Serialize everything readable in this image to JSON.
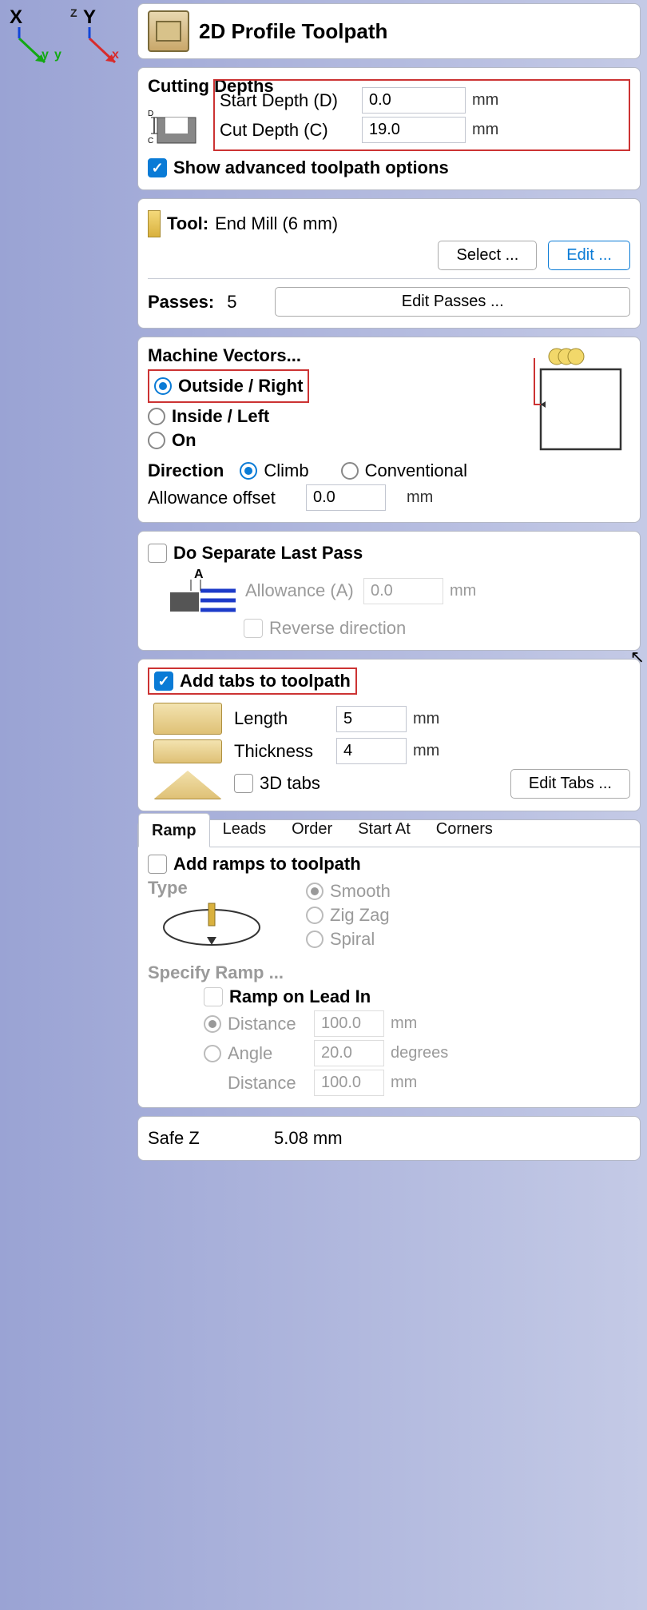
{
  "axes": {
    "x_label": "X",
    "y_label": "Y",
    "z_label": "Z",
    "sub_y": "y",
    "sub_x": "x"
  },
  "header": {
    "title": "2D Profile Toolpath"
  },
  "depths": {
    "section": "Cutting Depths",
    "start_label": "Start Depth (D)",
    "start_value": "0.0",
    "cut_label": "Cut Depth (C)",
    "cut_value": "19.0",
    "unit": "mm",
    "show_advanced": "Show advanced toolpath options"
  },
  "tool": {
    "label": "Tool:",
    "name": "End Mill (6 mm)",
    "select_btn": "Select ...",
    "edit_btn": "Edit ...",
    "passes_label": "Passes:",
    "passes_value": "5",
    "edit_passes_btn": "Edit Passes ..."
  },
  "vectors": {
    "section": "Machine Vectors...",
    "outside": "Outside / Right",
    "inside": "Inside / Left",
    "on": "On",
    "direction_label": "Direction",
    "climb": "Climb",
    "conventional": "Conventional",
    "allowance_label": "Allowance offset",
    "allowance_value": "0.0",
    "unit": "mm"
  },
  "lastpass": {
    "do_label": "Do Separate Last Pass",
    "allowance_label": "Allowance (A)",
    "allowance_value": "0.0",
    "unit": "mm",
    "reverse": "Reverse direction"
  },
  "tabs_section": {
    "add_label": "Add tabs to toolpath",
    "length_label": "Length",
    "length_value": "5",
    "thickness_label": "Thickness",
    "thickness_value": "4",
    "unit": "mm",
    "threed": "3D tabs",
    "edit_btn": "Edit Tabs ..."
  },
  "tabs": {
    "ramp": "Ramp",
    "leads": "Leads",
    "order": "Order",
    "start_at": "Start At",
    "corners": "Corners"
  },
  "ramp": {
    "add_label": "Add ramps to toolpath",
    "type_label": "Type",
    "smooth": "Smooth",
    "zigzag": "Zig Zag",
    "spiral": "Spiral",
    "specify": "Specify Ramp ...",
    "on_lead": "Ramp on Lead In",
    "distance_label": "Distance",
    "distance_value": "100.0",
    "unit_mm": "mm",
    "angle_label": "Angle",
    "angle_value": "20.0",
    "unit_deg": "degrees",
    "distance2_label": "Distance",
    "distance2_value": "100.0"
  },
  "safez": {
    "label": "Safe Z",
    "value": "5.08 mm"
  }
}
